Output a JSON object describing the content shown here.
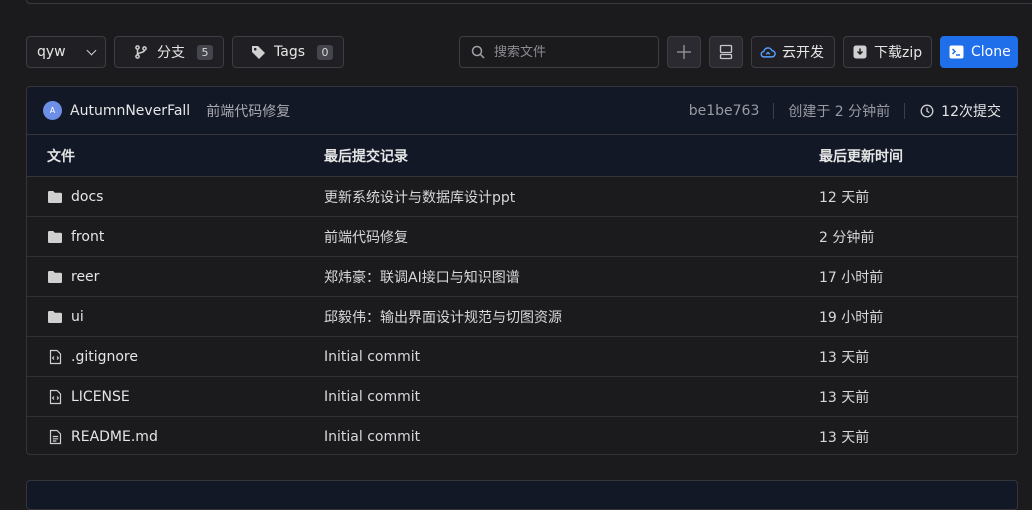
{
  "toolbar": {
    "branch_select": "qyw",
    "branches_label": "分支",
    "branches_count": "5",
    "tags_label": "Tags",
    "tags_count": "0",
    "search_placeholder": "搜索文件",
    "cloud_label": "云开发",
    "zip_label": "下载zip",
    "clone_label": "Clone"
  },
  "commit": {
    "avatar_letter": "A",
    "author": "AutumnNeverFall",
    "message": "前端代码修复",
    "hash": "be1be763",
    "created": "创建于 2 分钟前",
    "commits_count": "12次提交"
  },
  "table": {
    "headers": {
      "file": "文件",
      "last_commit": "最后提交记录",
      "updated": "最后更新时间"
    },
    "rows": [
      {
        "name": "docs",
        "type": "folder",
        "message": "更新系统设计与数据库设计ppt",
        "time": "12 天前"
      },
      {
        "name": "front",
        "type": "folder",
        "message": "前端代码修复",
        "time": "2 分钟前"
      },
      {
        "name": "reer",
        "type": "folder",
        "message": "郑炜豪：联调AI接口与知识图谱",
        "time": "17 小时前"
      },
      {
        "name": "ui",
        "type": "folder",
        "message": "邱毅伟：输出界面设计规范与切图资源",
        "time": "19 小时前"
      },
      {
        "name": ".gitignore",
        "type": "code-file",
        "message": "Initial commit",
        "time": "13 天前"
      },
      {
        "name": "LICENSE",
        "type": "code-file",
        "message": "Initial commit",
        "time": "13 天前"
      },
      {
        "name": "README.md",
        "type": "text-file",
        "message": "Initial commit",
        "time": "13 天前"
      }
    ]
  },
  "colors": {
    "accent": "#1f6feb",
    "header_bg": "#121826",
    "page_bg": "#1b1b1e"
  }
}
